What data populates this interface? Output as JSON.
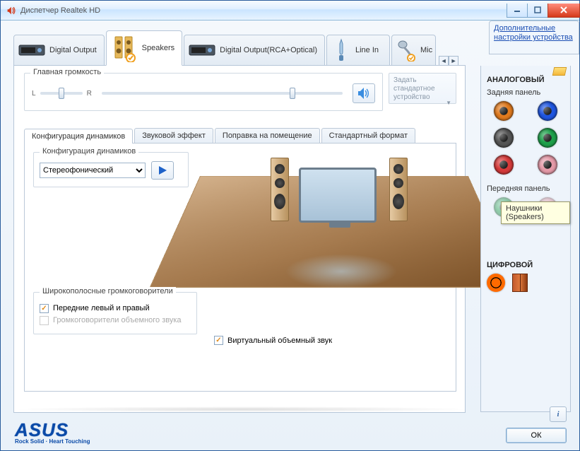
{
  "window": {
    "title": "Диспетчер Realtek HD"
  },
  "tabs": {
    "items": [
      {
        "label": "Digital Output"
      },
      {
        "label": "Speakers"
      },
      {
        "label": "Digital Output(RCA+Optical)"
      },
      {
        "label": "Line In"
      },
      {
        "label": "Mic"
      }
    ],
    "advanced_link": "Дополнительные настройки устройства"
  },
  "volume": {
    "legend": "Главная громкость",
    "left_label": "L",
    "right_label": "R",
    "default_device_btn": "Задать стандартное устройство"
  },
  "inner_tabs": {
    "items": [
      {
        "label": "Конфигурация динамиков"
      },
      {
        "label": "Звуковой эффект"
      },
      {
        "label": "Поправка на помещение"
      },
      {
        "label": "Стандартный формат"
      }
    ]
  },
  "speaker_config": {
    "legend": "Конфигурация динамиков",
    "selected": "Стереофонический"
  },
  "fullrange": {
    "legend": "Широкополосные громкоговорители",
    "front_lr": "Передние левый и правый",
    "surround": "Громкоговорители объемного звука"
  },
  "virtual_surround": {
    "label": "Виртуальный объемный звук"
  },
  "right_panel": {
    "analog_heading": "АНАЛОГОВЫЙ",
    "rear_label": "Задняя панель",
    "front_label": "Передняя панель",
    "digital_heading": "ЦИФРОВОЙ",
    "tooltip": "Наушники (Speakers)",
    "jack_colors": {
      "orange": "#e07a1e",
      "blue": "#1e55e0",
      "black": "#444",
      "green": "#1ea04a",
      "red": "#d63a3a",
      "pink": "#e59aa8",
      "front_green": "#1ea04a",
      "front_pink": "#e59aa8"
    }
  },
  "footer": {
    "brand": "ASUS",
    "tagline": "Rock Solid · Heart Touching",
    "ok": "ОК"
  }
}
